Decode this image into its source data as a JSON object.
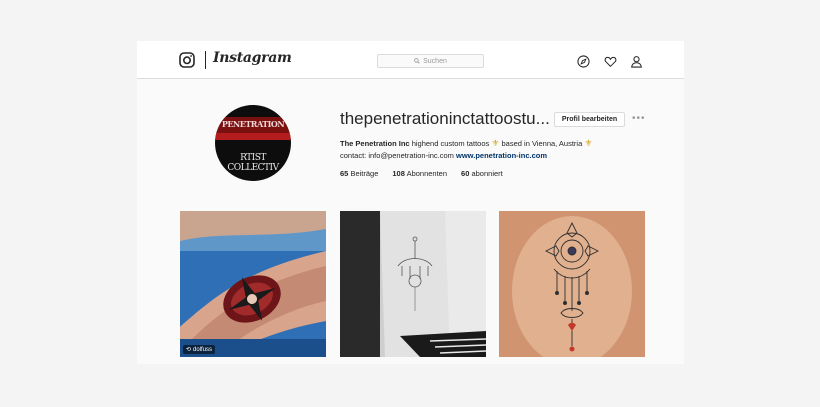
{
  "header": {
    "logo_icon": "instagram-camera-icon",
    "wordmark": "Instagram",
    "search_placeholder": "Suchen",
    "nav_icons": [
      "compass-icon",
      "heart-icon",
      "user-icon"
    ]
  },
  "profile": {
    "username": "thepenetrationinctattoostu...",
    "edit_button": "Profil bearbeiten",
    "more_icon": "more-dots-icon",
    "avatar_text_top": "PENETRATION",
    "avatar_text_bottom": "RTIST COLLECTIV",
    "bio": {
      "name": "The Penetration Inc",
      "line1_rest": " highend custom tattoos",
      "fleur1": "⚜",
      "line1_tail": " based in Vienna, Austria ",
      "fleur2": "⚜",
      "contact": "contact: info@penetration-inc.com ",
      "link": "www.penetration-inc.com"
    },
    "stats": {
      "posts_count": "65",
      "posts_label": "Beiträge",
      "followers_count": "108",
      "followers_label": "Abonnenten",
      "following_count": "60",
      "following_label": "abonniert"
    }
  },
  "posts": [
    {
      "name": "post-tattoo-forearm-red"
    },
    {
      "name": "post-tattoo-forearm-bw"
    },
    {
      "name": "post-tattoo-back-mandala"
    }
  ],
  "post1_credit": "dolfuss",
  "colors": {
    "accent_link": "#003569",
    "fleur": "#d4a21e"
  }
}
